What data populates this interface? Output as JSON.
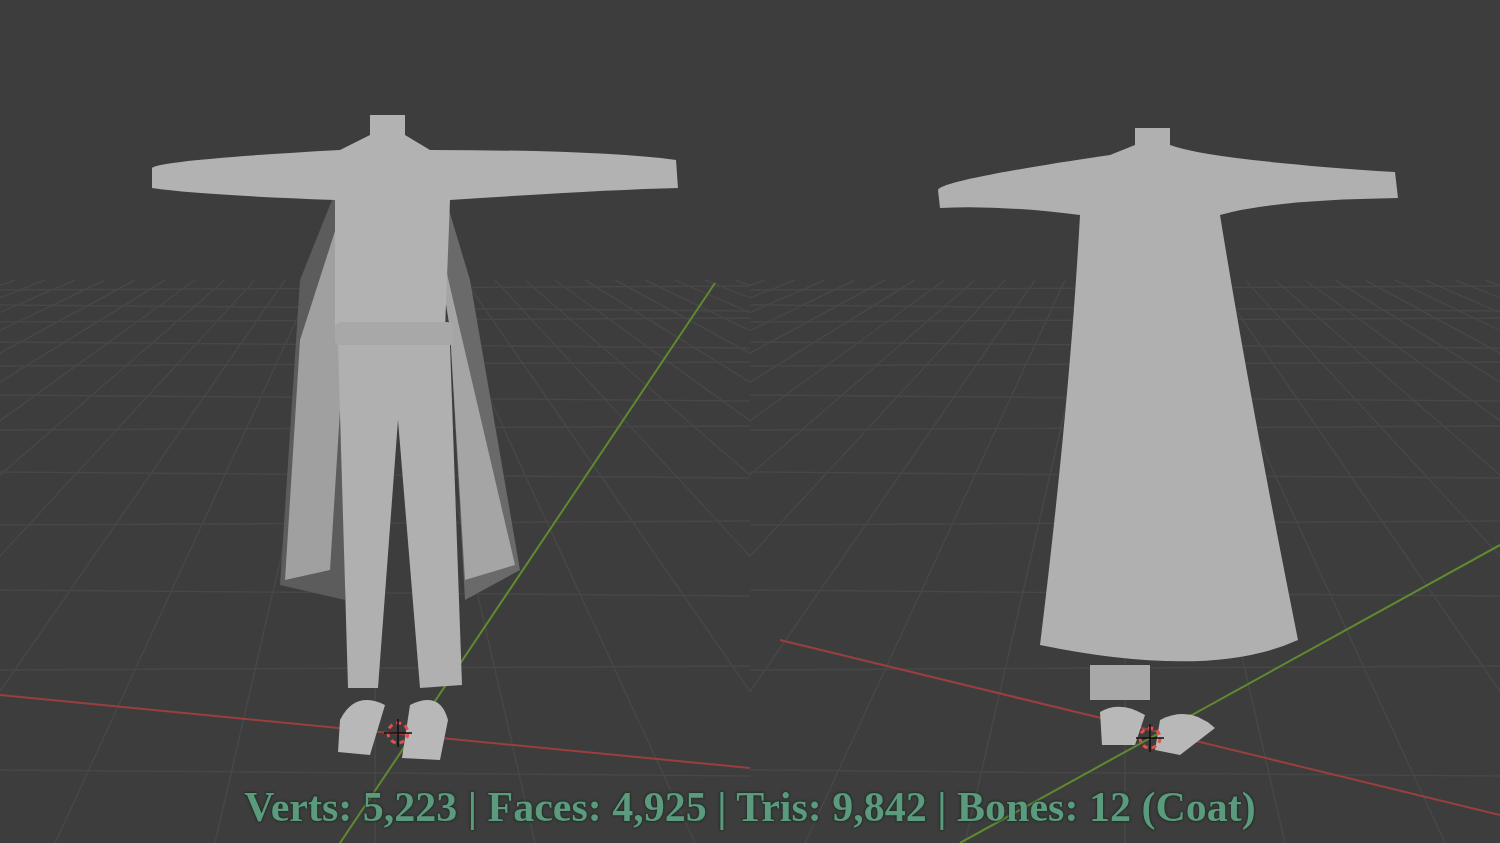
{
  "caption": "Verts: 5,223 | Faces: 4,925 | Tris: 9,842 | Bones: 12 (Coat)"
}
